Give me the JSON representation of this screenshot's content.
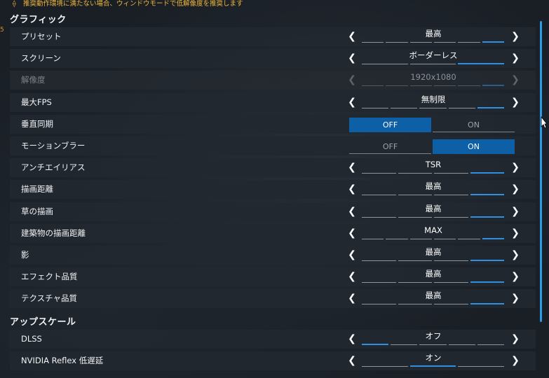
{
  "warning": {
    "icon": "warning-icon",
    "text": "推奨動作環境に満たない場合、ウィンドウモードで低解像度を推奨します"
  },
  "sections": [
    {
      "title": "グラフィック",
      "rows": [
        {
          "label": "プリセット",
          "type": "select",
          "value": "最高",
          "segments": 6,
          "active": 5,
          "disabled": false
        },
        {
          "label": "スクリーン",
          "type": "select",
          "value": "ボーダーレス",
          "segments": 3,
          "active": 2,
          "disabled": false
        },
        {
          "label": "解像度",
          "type": "select",
          "value": "1920x1080",
          "segments": 6,
          "active": 5,
          "disabled": true
        },
        {
          "label": "最大FPS",
          "type": "select",
          "value": "無制限",
          "segments": 5,
          "active": 4,
          "disabled": false
        },
        {
          "label": "垂直同期",
          "type": "toggle",
          "off_label": "OFF",
          "on_label": "ON",
          "selected": "off"
        },
        {
          "label": "モーションブラー",
          "type": "toggle",
          "off_label": "OFF",
          "on_label": "ON",
          "selected": "on"
        },
        {
          "label": "アンチエイリアス",
          "type": "select",
          "value": "TSR",
          "segments": 4,
          "active": 3,
          "disabled": false
        },
        {
          "label": "描画距離",
          "type": "select",
          "value": "最高",
          "segments": 4,
          "active": 3,
          "disabled": false
        },
        {
          "label": "草の描画",
          "type": "select",
          "value": "最高",
          "segments": 4,
          "active": 3,
          "disabled": false
        },
        {
          "label": "建築物の描画距離",
          "type": "select",
          "value": "MAX",
          "segments": 6,
          "active": 5,
          "disabled": false
        },
        {
          "label": "影",
          "type": "select",
          "value": "最高",
          "segments": 4,
          "active": 3,
          "disabled": false
        },
        {
          "label": "エフェクト品質",
          "type": "select",
          "value": "最高",
          "segments": 4,
          "active": 3,
          "disabled": false
        },
        {
          "label": "テクスチャ品質",
          "type": "select",
          "value": "最高",
          "segments": 4,
          "active": 3,
          "disabled": false
        }
      ]
    },
    {
      "title": "アップスケール",
      "rows": [
        {
          "label": "DLSS",
          "type": "select",
          "value": "オフ",
          "segments": 5,
          "active": 0,
          "disabled": false
        },
        {
          "label": "NVIDIA Reflex 低遅延",
          "type": "select",
          "value": "オン",
          "segments": 3,
          "active": 1,
          "disabled": false
        }
      ]
    }
  ],
  "colors": {
    "accent": "#2f8fe0",
    "toggle_selected": "#0d5fa6",
    "warning": "#f0b93a"
  }
}
